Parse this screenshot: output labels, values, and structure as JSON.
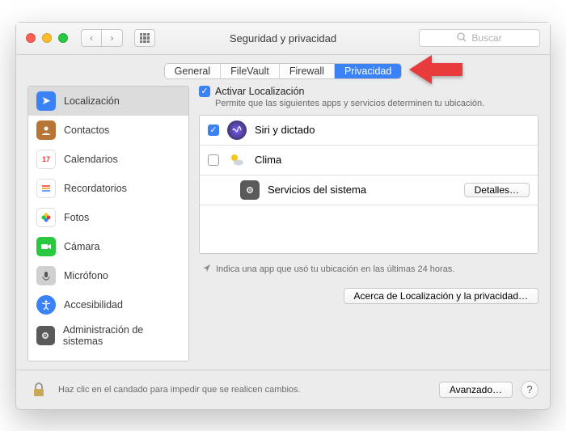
{
  "window": {
    "title": "Seguridad y privacidad"
  },
  "search": {
    "placeholder": "Buscar"
  },
  "tabs": [
    "General",
    "FileVault",
    "Firewall",
    "Privacidad"
  ],
  "active_tab_index": 3,
  "sidebar": {
    "items": [
      {
        "label": "Localización",
        "selected": true
      },
      {
        "label": "Contactos"
      },
      {
        "label": "Calendarios"
      },
      {
        "label": "Recordatorios"
      },
      {
        "label": "Fotos"
      },
      {
        "label": "Cámara"
      },
      {
        "label": "Micrófono"
      },
      {
        "label": "Accesibilidad"
      },
      {
        "label": "Administración de sistemas"
      }
    ]
  },
  "main": {
    "activate_label": "Activar Localización",
    "activate_checked": true,
    "permit_text": "Permite que las siguientes apps y servicios determinen tu ubicación.",
    "apps": [
      {
        "name": "Siri y dictado",
        "checked": true
      },
      {
        "name": "Clima",
        "checked": false
      }
    ],
    "system_label": "Servicios del sistema",
    "details_label": "Detalles…",
    "note_text": "Indica una app que usó tu ubicación en las últimas 24 horas.",
    "about_label": "Acerca de Localización y la privacidad…"
  },
  "footer": {
    "lock_text": "Haz clic en el candado para impedir que se realicen cambios.",
    "advanced_label": "Avanzado…"
  }
}
